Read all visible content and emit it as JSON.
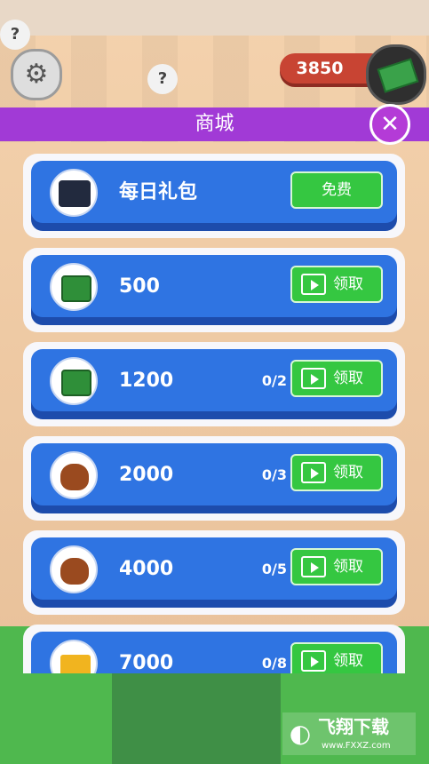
{
  "hud": {
    "cash_amount": "3850"
  },
  "shop": {
    "title": "商城",
    "items": [
      {
        "label": "每日礼包",
        "counter": "",
        "button_label": "免费",
        "icon": "briefcase-icon"
      },
      {
        "label": "500",
        "counter": "",
        "button_label": "领取",
        "icon": "cash-stack-icon"
      },
      {
        "label": "1200",
        "counter": "0/2",
        "button_label": "领取",
        "icon": "cash-stack-icon"
      },
      {
        "label": "2000",
        "counter": "0/3",
        "button_label": "领取",
        "icon": "money-bag-icon"
      },
      {
        "label": "4000",
        "counter": "0/5",
        "button_label": "领取",
        "icon": "money-bag-coins-icon"
      },
      {
        "label": "7000",
        "counter": "0/8",
        "button_label": "领取",
        "icon": "gold-bars-icon"
      }
    ]
  },
  "watermark": {
    "title": "飞翔下载",
    "url": "www.FXXZ.com"
  },
  "colors": {
    "title_bar": "#a13ad6",
    "card_blue": "#2f74e2",
    "button_green": "#35c741"
  }
}
